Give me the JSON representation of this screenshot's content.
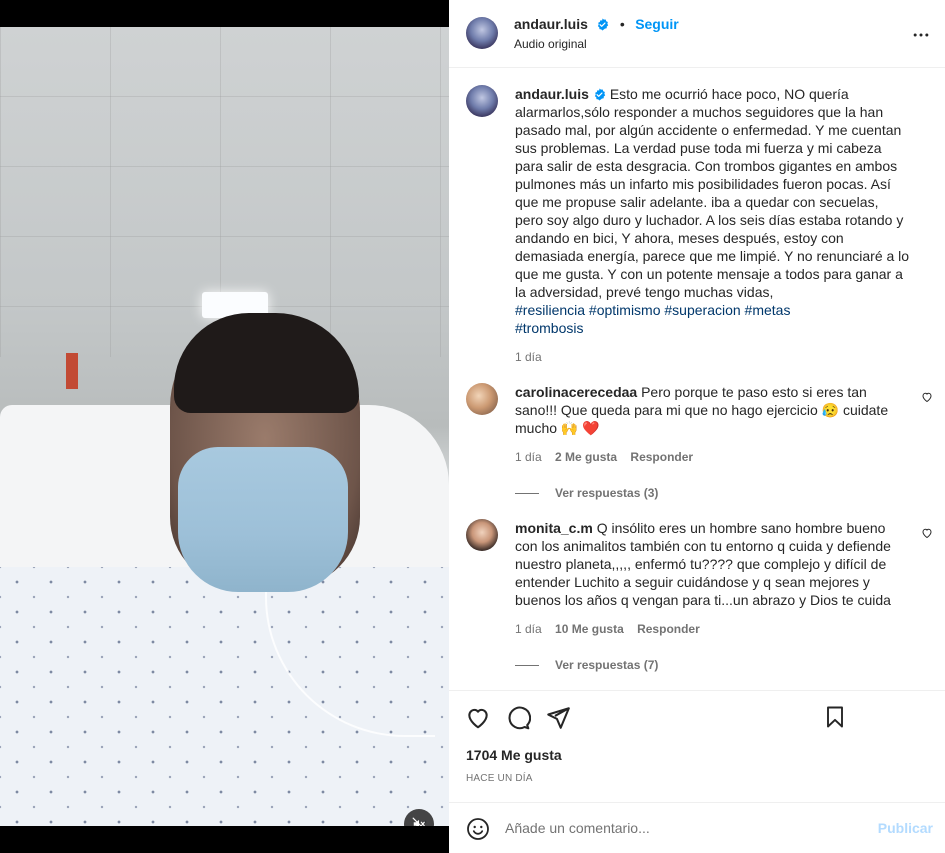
{
  "post": {
    "username": "andaur.luis",
    "follow_label": "Seguir",
    "audio_label": "Audio original",
    "more_icon": "more-options-icon",
    "caption": "Esto me ocurrió hace poco, NO quería alarmarlos,sólo responder a muchos seguidores que la han pasado mal, por algún accidente o enfermedad. Y me cuentan sus problemas. La verdad puse toda mi fuerza y mi cabeza para salir de esta desgracia. Con trombos gigantes en ambos pulmones más un infarto mis posibilidades fueron pocas. Así que me propuse salir adelante. iba a quedar con secuelas, pero soy algo duro y luchador. A los seis días estaba rotando y andando en bici, Y ahora, meses después, estoy con demasiada energía, parece que me limpié. Y no renunciaré a lo que me gusta. Y con un potente mensaje a todos para ganar a la adversidad, prevé tengo muchas vidas,",
    "hashtags_line1": "#resiliencia #optimismo #superacion #metas",
    "hashtags_line2": "#trombosis",
    "time": "1 día"
  },
  "comments": [
    {
      "username": "carolinacerecedaa",
      "text": "Pero porque te paso esto si eres tan sano!!! Que queda para mi que no hago ejercicio 😥 cuidate mucho 🙌 ❤️",
      "time": "1 día",
      "likes": "2 Me gusta",
      "reply": "Responder",
      "view_replies": "Ver respuestas (3)"
    },
    {
      "username": "monita_c.m",
      "text": "Q insólito eres un hombre sano hombre bueno con los animalitos también con tu entorno q cuida y defiende nuestro planeta,,,,, enfermó tu???? que complejo y difícil de entender Luchito a seguir cuidándose y q sean mejores y buenos los años q vengan para ti...un abrazo y Dios te cuida",
      "time": "1 día",
      "likes": "10 Me gusta",
      "reply": "Responder",
      "view_replies": "Ver respuestas (7)"
    }
  ],
  "actions": {
    "likes_count": "1704 Me gusta",
    "posted_time": "HACE UN DÍA"
  },
  "composer": {
    "placeholder": "Añade un comentario...",
    "publish_label": "Publicar"
  },
  "colors": {
    "link_blue": "#0095f6",
    "hashtag_blue": "#00376b",
    "publish_disabled": "#b3dbff",
    "verified_badge": "#0095f6"
  }
}
